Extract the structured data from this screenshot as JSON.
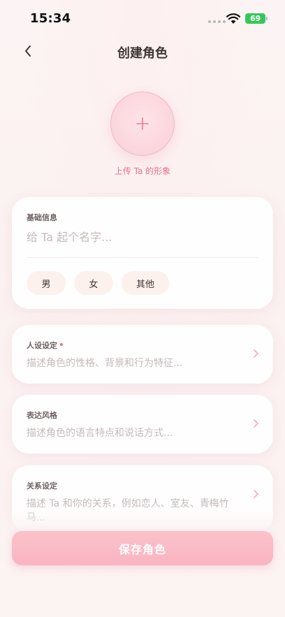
{
  "status_bar": {
    "time": "15:34",
    "battery": "69",
    "battery_color": "#35c759"
  },
  "nav": {
    "title": "创建角色",
    "back_icon": "chevron-left-icon"
  },
  "avatar": {
    "icon": "plus-icon",
    "label": "上传 Ta 的形象",
    "accent": "#ec6f8a"
  },
  "basic_info": {
    "label": "基础信息",
    "name_placeholder": "给 Ta 起个名字...",
    "name_value": "",
    "genders": [
      "男",
      "女",
      "其他"
    ]
  },
  "persona": {
    "label": "人设设定",
    "required": true,
    "placeholder": "描述角色的性格、背景和行为特征..."
  },
  "style": {
    "label": "表达风格",
    "placeholder": "描述角色的语言特点和说话方式..."
  },
  "relation": {
    "label": "关系设定",
    "placeholder": "描述 Ta 和你的关系，例如恋人、室友、青梅竹马..."
  },
  "save_button": {
    "label": "保存角色",
    "color": "#f9b4c0"
  }
}
